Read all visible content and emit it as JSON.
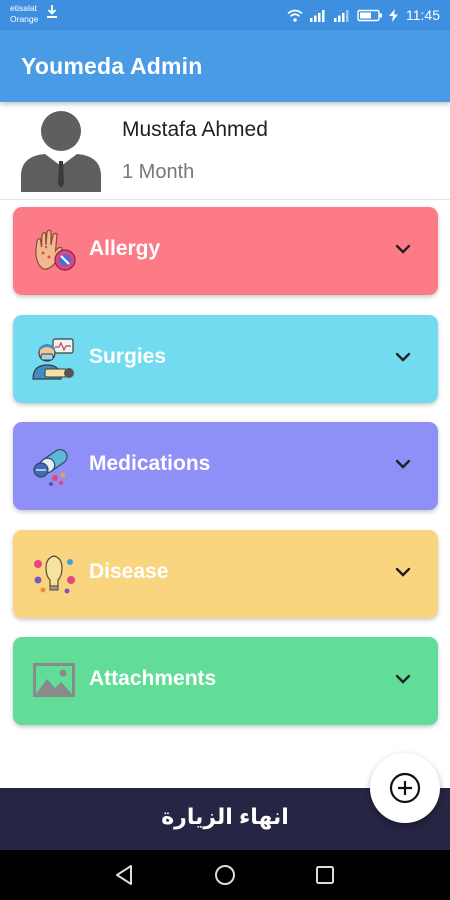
{
  "status_bar": {
    "carrier_line1": "etisalat",
    "carrier_line2": "Orange",
    "time": "11:45",
    "icons": [
      "download-icon",
      "wifi-icon",
      "signal-icon",
      "signal-icon",
      "battery-icon",
      "charging-icon"
    ]
  },
  "app_bar": {
    "title": "Youmeda Admin"
  },
  "profile": {
    "name": "Mustafa Ahmed",
    "subtitle": "1 Month",
    "avatar_icon": "user-avatar-icon"
  },
  "sections": [
    {
      "label": "Allergy",
      "color": "#fd7b86",
      "icon": "allergy-hand-icon"
    },
    {
      "label": "Surgies",
      "color": "#73dbef",
      "icon": "surgeon-icon"
    },
    {
      "label": "Medications",
      "color": "#8f8ff8",
      "icon": "pills-icon"
    },
    {
      "label": "Disease",
      "color": "#f8d57e",
      "icon": "virus-icon"
    },
    {
      "label": "Attachments",
      "color": "#62dd98",
      "icon": "image-icon"
    }
  ],
  "end_visit": {
    "label": "انهاء الزيارة",
    "color": "#262543"
  },
  "fab": {
    "icon": "add-circle-icon"
  },
  "nav": {
    "icons": [
      "back-icon",
      "home-icon",
      "recents-icon"
    ]
  }
}
